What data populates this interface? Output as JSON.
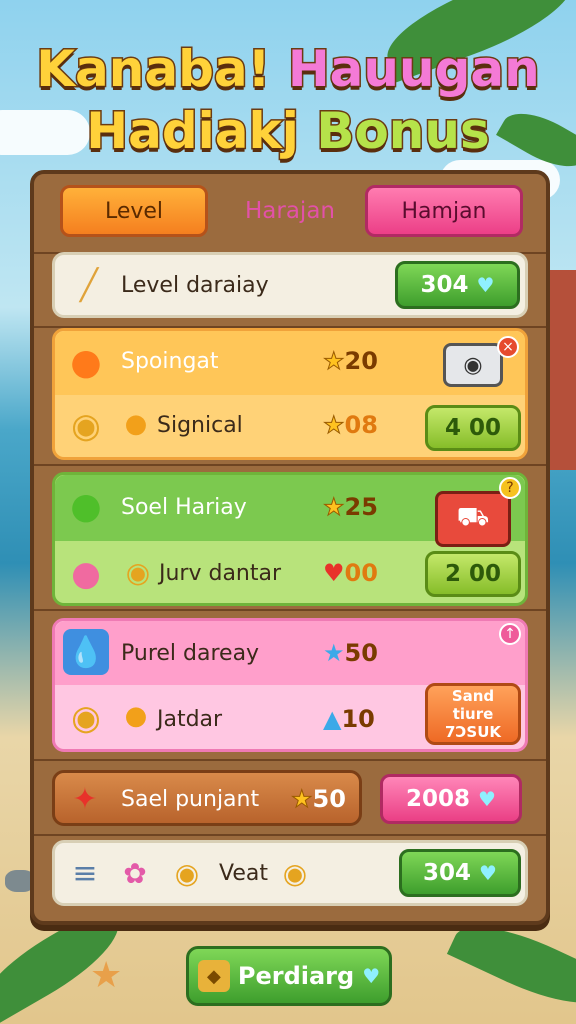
{
  "title": {
    "line1_a": "Kanaba!",
    "line1_b": "Hauugan",
    "line2_a": "Hadiakj",
    "line2_b": "Bonus"
  },
  "tabs": {
    "level": "Level",
    "harajan": "Harajan",
    "hamjan": "Hamjan"
  },
  "rows": {
    "level_daraiay": {
      "label": "Level daraiay",
      "value": "304"
    },
    "spoingat": {
      "label": "Spoingat",
      "stars": "20"
    },
    "signical": {
      "label": "Signical",
      "stars": "08",
      "value": "4 00"
    },
    "soel_hariay": {
      "label": "Soel Hariay",
      "stars": "25"
    },
    "jurv_dantar": {
      "label": "Jurv dantar",
      "stars": "00",
      "value": "2 00"
    },
    "purel_dareay": {
      "label": "Purel dareay",
      "stars": "50"
    },
    "jatdar": {
      "label": "Jatdar",
      "stars": "10",
      "reward_line1": "Sand",
      "reward_line2": "tiure",
      "reward_line3": "7ƆSUK"
    },
    "sael_punjant": {
      "label": "Sael punjant",
      "stars": "50",
      "value": "2008"
    },
    "veat": {
      "label": "Veat",
      "value": "304"
    }
  },
  "footer": {
    "button_label": "Perdiarg"
  },
  "colors": {
    "accent_green": "#3e9e2d",
    "accent_pink": "#ea3f85",
    "accent_orange": "#f57f1f",
    "wood": "#9b6b3e"
  }
}
